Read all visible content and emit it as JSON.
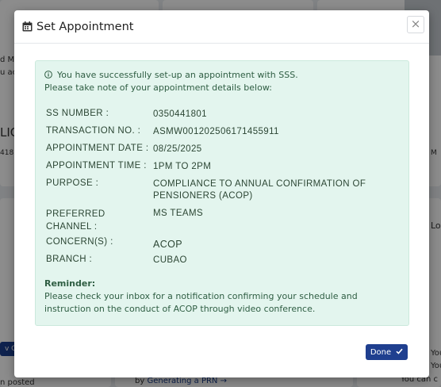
{
  "background": {
    "fragments": [
      "d M",
      "u ac",
      "LIC",
      "418",
      "M",
      "Lo",
      "v Co",
      "n posted",
      "by",
      "Generating a PRN →",
      "You p",
      "You c",
      "You can c"
    ]
  },
  "modal": {
    "title": "Set Appointment",
    "close_label": "×",
    "success_message": "You have successfully set-up an appointment with SSS.",
    "note_message": "Please take note of your appointment details below:",
    "details": [
      {
        "label": "SS NUMBER :",
        "value": "0350441801"
      },
      {
        "label": "TRANSACTION NO. :",
        "value": "ASMW001202506171455911"
      },
      {
        "label": "APPOINTMENT DATE :",
        "value": "08/25/2025"
      },
      {
        "label": "APPOINTMENT TIME :",
        "value": "1PM TO 2PM"
      },
      {
        "label": "PURPOSE :",
        "value": "COMPLIANCE TO ANNUAL CONFIRMATION OF PENSIONERS (ACOP)"
      },
      {
        "label": "PREFERRED CHANNEL :",
        "value": "MS TEAMS"
      },
      {
        "label": "CONCERN(S) :",
        "value": "ACOP"
      },
      {
        "label": "BRANCH :",
        "value": "CUBAO"
      }
    ],
    "reminder_heading": "Reminder:",
    "reminder_text": "Please check your inbox for a notification confirming your schedule and instruction on the conduct of ACOP through video conference.",
    "done_label": "Done"
  },
  "colors": {
    "accent": "#1f3f8f",
    "success_bg": "#e3f5ee",
    "success_text": "#2f5e43"
  },
  "icons": [
    "calendar-icon",
    "close-icon",
    "info-icon",
    "checkmark-icon"
  ]
}
